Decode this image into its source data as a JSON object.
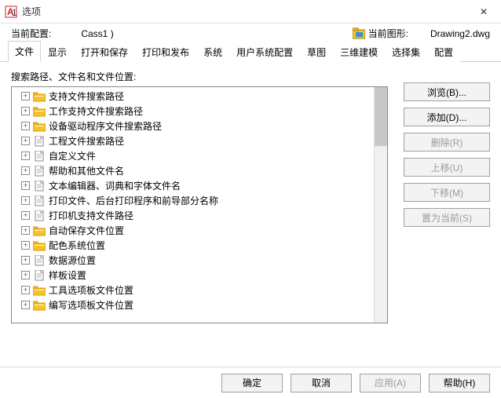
{
  "window": {
    "title": "选项",
    "close_glyph": "✕"
  },
  "info": {
    "profile_label": "当前配置:",
    "profile_value": "Cass1  )",
    "drawing_label": "当前图形:",
    "drawing_value": "Drawing2.dwg"
  },
  "tabs": [
    "文件",
    "显示",
    "打开和保存",
    "打印和发布",
    "系统",
    "用户系统配置",
    "草图",
    "三维建模",
    "选择集",
    "配置"
  ],
  "active_tab": 0,
  "section_label": "搜索路径、文件名和文件位置:",
  "tree": [
    {
      "icon": "folder-yellow",
      "label": "支持文件搜索路径"
    },
    {
      "icon": "folder-yellow",
      "label": "工作支持文件搜索路径"
    },
    {
      "icon": "folder-yellow",
      "label": "设备驱动程序文件搜索路径"
    },
    {
      "icon": "file",
      "label": "工程文件搜索路径"
    },
    {
      "icon": "file",
      "label": "自定义文件"
    },
    {
      "icon": "file",
      "label": "帮助和其他文件名"
    },
    {
      "icon": "file",
      "label": "文本编辑器、词典和字体文件名"
    },
    {
      "icon": "file",
      "label": "打印文件、后台打印程序和前导部分名称"
    },
    {
      "icon": "file",
      "label": "打印机支持文件路径"
    },
    {
      "icon": "folder-yellow",
      "label": "自动保存文件位置"
    },
    {
      "icon": "folder-yellow",
      "label": "配色系统位置"
    },
    {
      "icon": "file",
      "label": "数据源位置"
    },
    {
      "icon": "file",
      "label": "样板设置"
    },
    {
      "icon": "folder-yellow",
      "label": "工具选项板文件位置"
    },
    {
      "icon": "folder-yellow",
      "label": "编写选项板文件位置"
    }
  ],
  "side_buttons": [
    {
      "label": "浏览(B)...",
      "enabled": true
    },
    {
      "label": "添加(D)...",
      "enabled": true
    },
    {
      "label": "删除(R)",
      "enabled": false
    },
    {
      "label": "上移(U)",
      "enabled": false
    },
    {
      "label": "下移(M)",
      "enabled": false
    },
    {
      "label": "置为当前(S)",
      "enabled": false
    }
  ],
  "footer": {
    "ok": "确定",
    "cancel": "取消",
    "apply": "应用(A)",
    "help": "帮助(H)"
  },
  "colors": {
    "folder_yellow": "#f5c328",
    "folder_side": "#d89e10",
    "file_white": "#ffffff",
    "file_border": "#888888",
    "app_red": "#c8202a"
  }
}
